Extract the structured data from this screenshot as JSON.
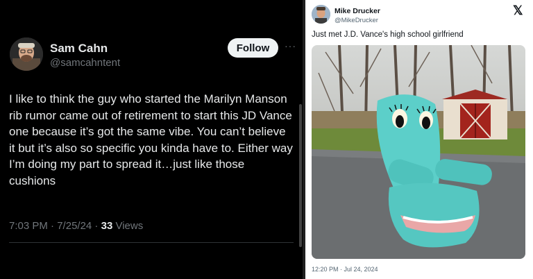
{
  "left_tweet": {
    "display_name": "Sam Cahn",
    "handle": "@samcahntent",
    "follow_label": "Follow",
    "more_label": "···",
    "text": "I like to think the guy who started the Marilyn Manson rib rumor came out of retirement to start this JD Vance one because it’s got the same vibe. You can’t believe it but it’s also so specific you kinda have to. Either way I’m doing my part to spread it…just like those cushions",
    "time": "7:03 PM",
    "sep1": " · ",
    "date": "7/25/24",
    "sep2": " · ",
    "views_count": "33",
    "views_label": " Views"
  },
  "right_tweet": {
    "display_name": "Mike Drucker",
    "handle": "@MikeDrucker",
    "x_logo": "𝕏",
    "text": "Just met J.D. Vance's high school girlfriend",
    "timestamp": "12:20 PM · Jul 24, 2024"
  }
}
